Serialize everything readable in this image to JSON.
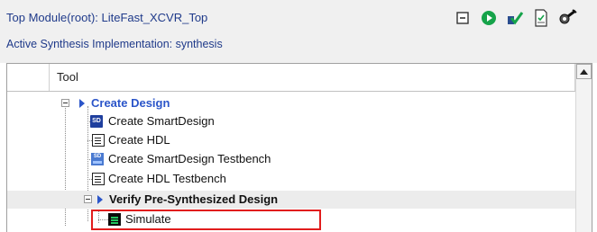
{
  "header": {
    "top_module": "Top Module(root): LiteFast_XCVR_Top",
    "active_impl": "Active Synthesis Implementation: synthesis"
  },
  "toolbar": {
    "icons": [
      "collapse-icon",
      "run-icon",
      "check-icon",
      "report-icon",
      "settings-icon"
    ]
  },
  "table": {
    "column_header": "Tool"
  },
  "tree": [
    {
      "label": "Create Design",
      "style": "group"
    },
    {
      "label": "Create SmartDesign",
      "icon": "smartdesign-icon"
    },
    {
      "label": "Create HDL",
      "icon": "hdl-document-icon"
    },
    {
      "label": "Create SmartDesign Testbench",
      "icon": "smartdesign-testbench-icon"
    },
    {
      "label": "Create HDL Testbench",
      "icon": "hdl-document-icon"
    },
    {
      "label": "Verify Pre-Synthesized Design",
      "style": "group-black"
    },
    {
      "label": "Simulate",
      "icon": "simulate-icon"
    }
  ],
  "colors": {
    "accent_blue": "#2b55c9",
    "header_text": "#1f3a8a",
    "highlight_box": "#e11d1d"
  }
}
